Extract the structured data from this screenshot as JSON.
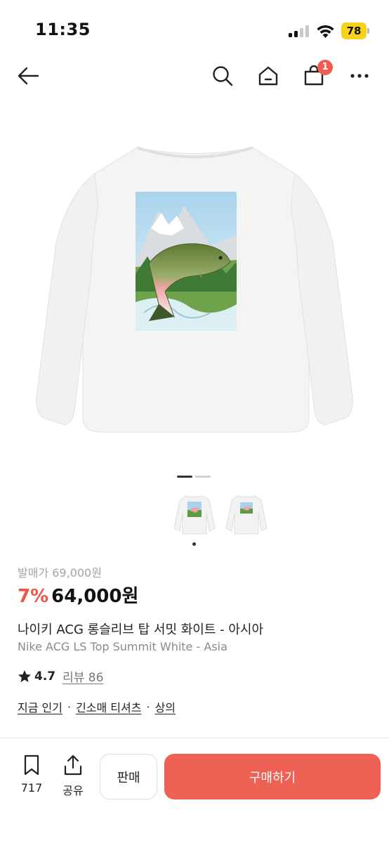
{
  "status": {
    "time": "11:35",
    "battery": "78"
  },
  "nav": {
    "cart_count": "1",
    "icons": [
      "back-arrow-icon",
      "search-icon",
      "home-icon",
      "shopping-bag-icon",
      "more-icon"
    ]
  },
  "gallery": {
    "current_page": 1,
    "total_pages": 2,
    "thumbnail_count": 2,
    "selected_thumbnail": 1
  },
  "product": {
    "release_price": "발매가 69,000원",
    "discount": "7%",
    "price": "64,000원",
    "title_ko": "나이키 ACG 롱슬리브 탑 서밋 화이트 - 아시아",
    "title_en": "Nike ACG LS Top Summit White - Asia",
    "rating": "4.7",
    "reviews": "리뷰 86",
    "tags": [
      "지금 인기",
      "긴소매 티셔츠",
      "상의"
    ],
    "tag_separator": "·"
  },
  "bottom_bar": {
    "bookmark_count": "717",
    "share_label": "공유",
    "sell_label": "판매",
    "buy_label": "구매하기"
  },
  "colors": {
    "accent": "#ef6154",
    "discount": "#ef5549",
    "badge": "#ef5c54",
    "battery": "#f6d21b"
  }
}
